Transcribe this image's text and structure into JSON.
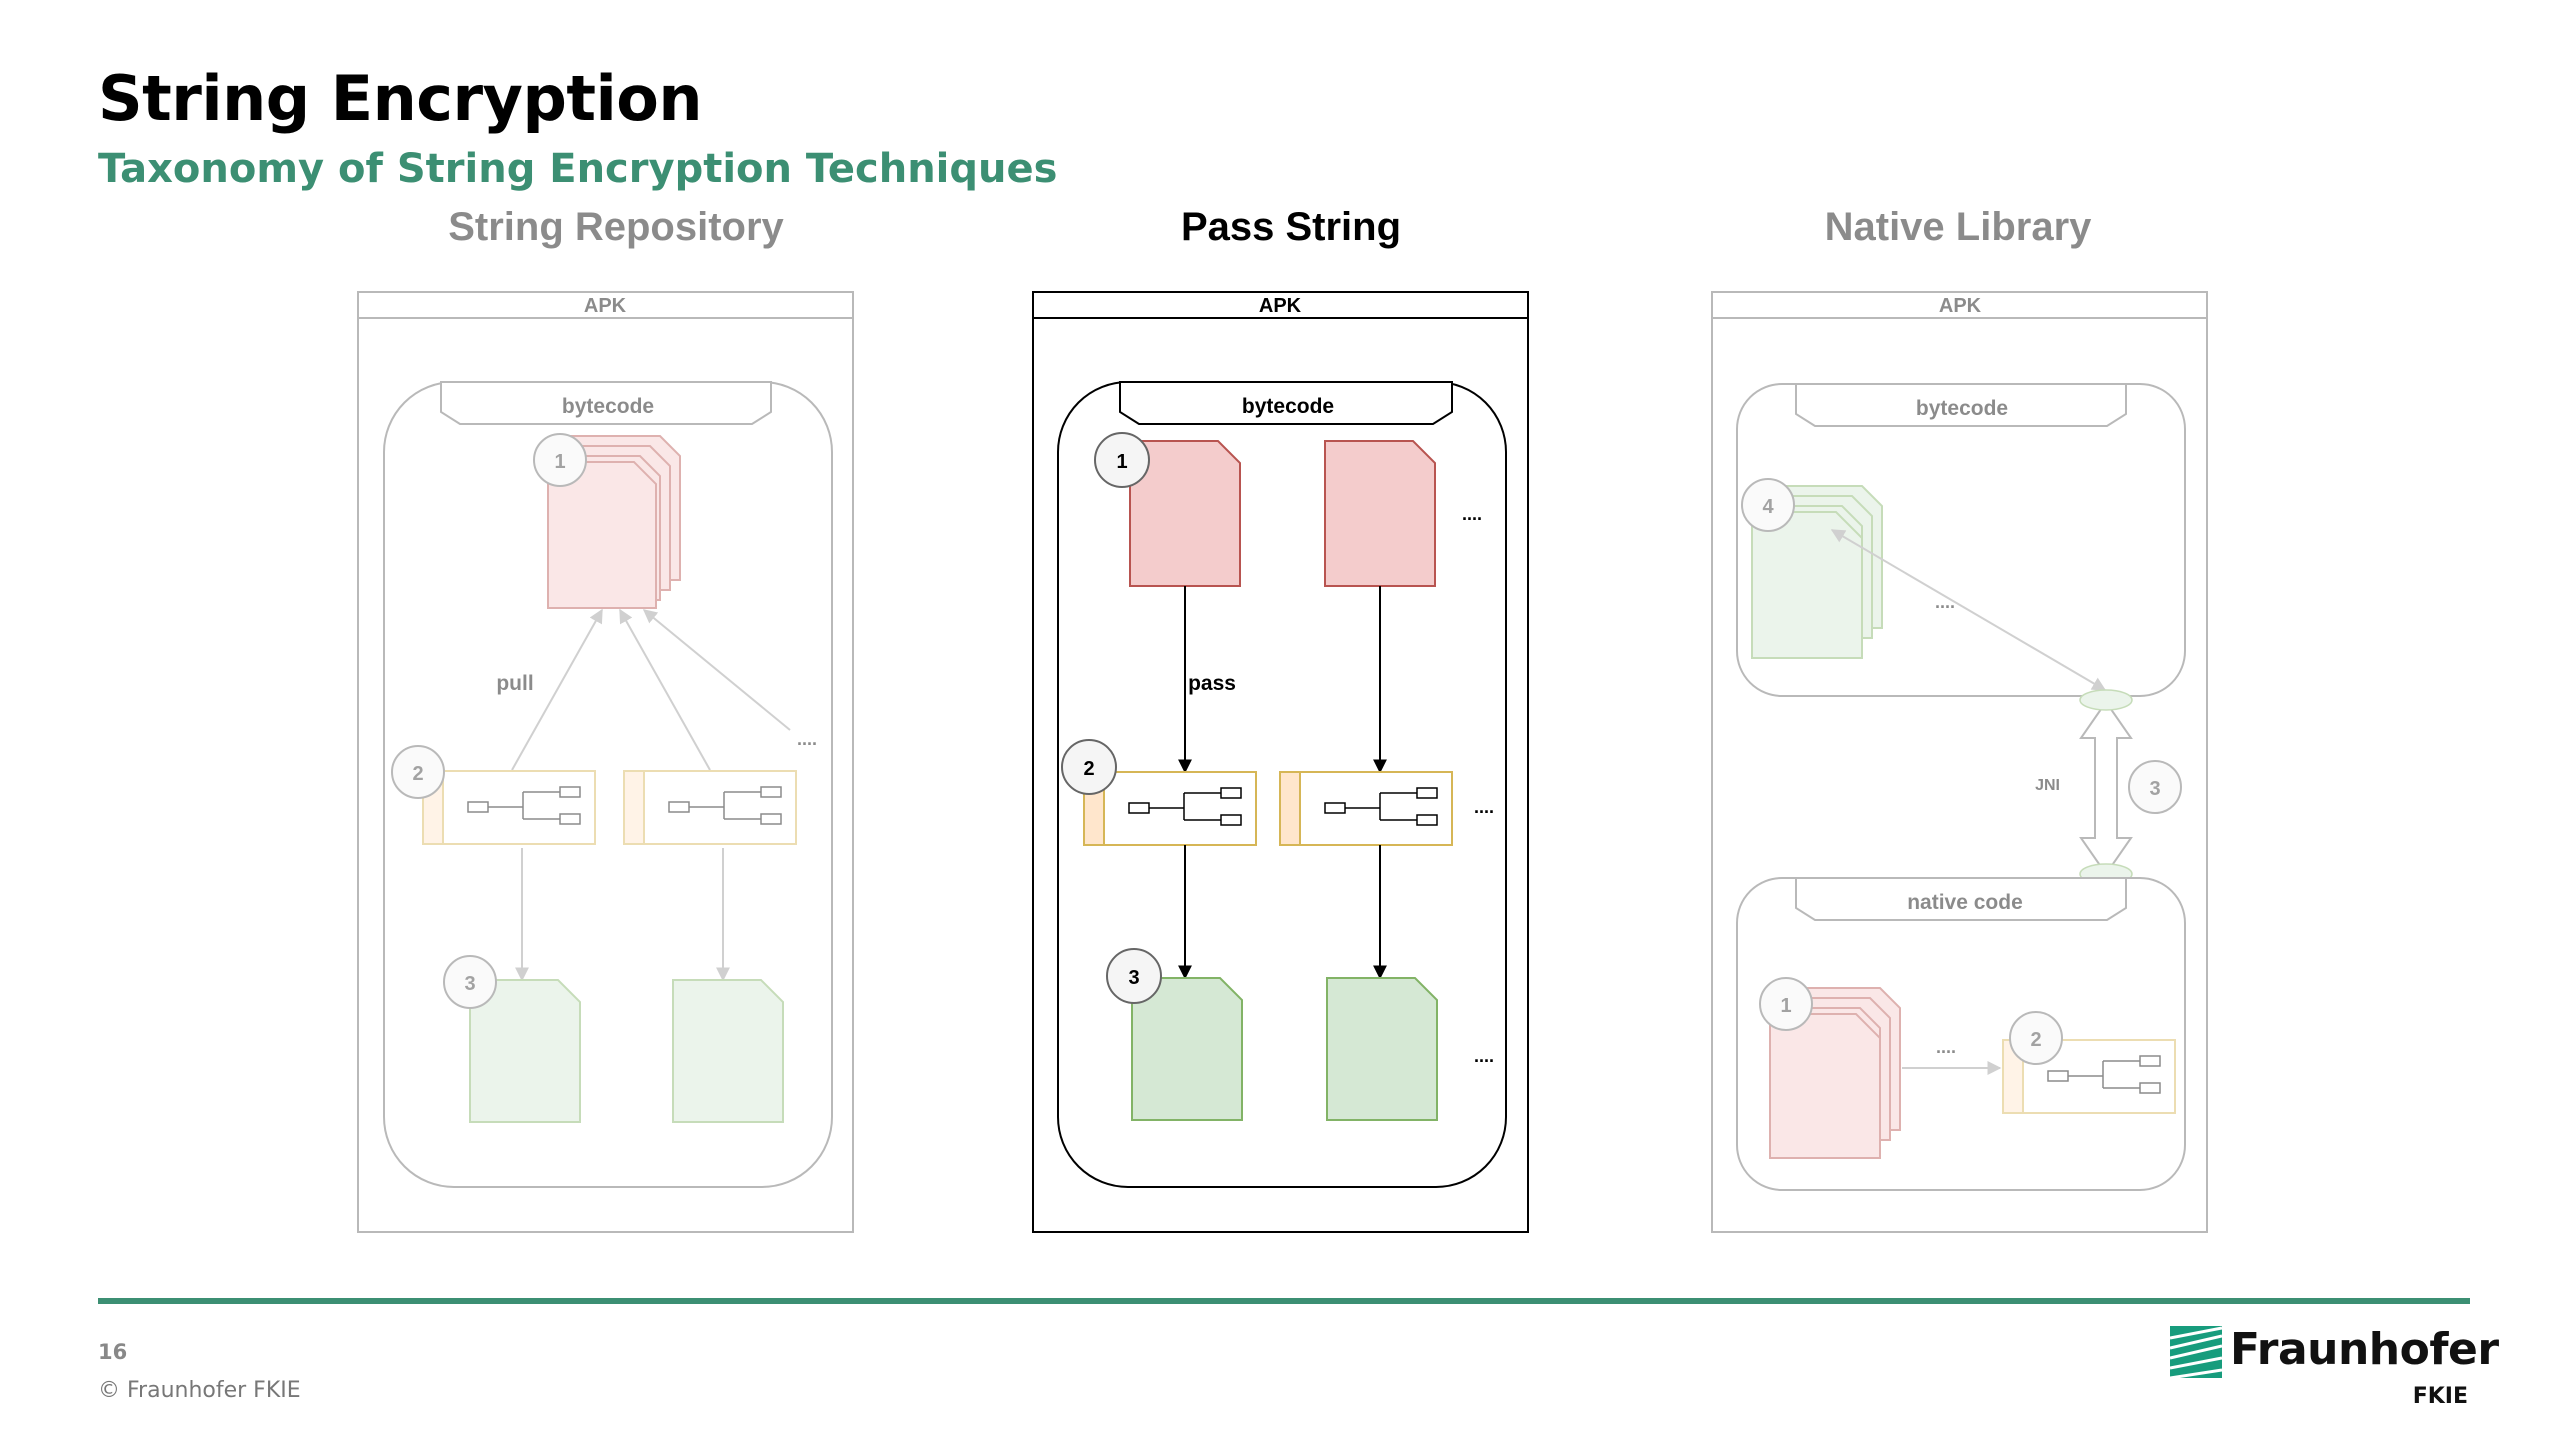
{
  "slide": {
    "title": "String Encryption",
    "subtitle": "Taxonomy of String Encryption Techniques",
    "page_number": "16",
    "copyright": "© Fraunhofer FKIE",
    "logo": {
      "name": "Fraunhofer",
      "unit": "FKIE",
      "icon": "fraunhofer-logo-icon"
    }
  },
  "panels": [
    {
      "heading": "String Repository",
      "state": "faded",
      "apk_label": "APK",
      "bytecode_label": "bytecode",
      "arrow_label": "pull",
      "badges": [
        "1",
        "2",
        "3"
      ],
      "ellipsis": "...."
    },
    {
      "heading": "Pass String",
      "state": "active",
      "apk_label": "APK",
      "bytecode_label": "bytecode",
      "arrow_label": "pass",
      "badges": [
        "1",
        "2",
        "3"
      ],
      "ellipses": [
        "....",
        "....",
        "...."
      ]
    },
    {
      "heading": "Native Library",
      "state": "faded",
      "apk_label": "APK",
      "bytecode_label": "bytecode",
      "native_label": "native code",
      "jni_label": "JNI",
      "badges": [
        "4",
        "3",
        "1",
        "2"
      ],
      "ellipses": [
        "....",
        "...."
      ]
    }
  ],
  "colors": {
    "accent": "#3c8f73",
    "encrypted_fill": "#f4cccc",
    "encrypted_stroke": "#b85450",
    "decrypted_fill": "#d5e8d4",
    "decrypted_stroke": "#82b366",
    "method_stroke": "#d6b656",
    "method_tab": "#ffe6cc"
  }
}
